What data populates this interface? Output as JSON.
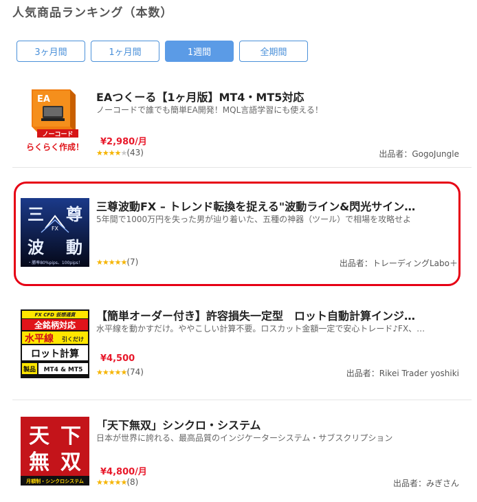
{
  "page_title": "人気商品ランキング（本数）",
  "tabs": [
    {
      "label": "3ヶ月間",
      "active": false
    },
    {
      "label": "1ヶ月間",
      "active": false
    },
    {
      "label": "1週間",
      "active": true
    },
    {
      "label": "全期間",
      "active": false
    }
  ],
  "products": [
    {
      "title": "EAつくーる【1ヶ月版】MT4・MT5対応",
      "description": "ノーコードで誰でも簡単EA開発！MQL言語学習にも使える！",
      "price": "¥2,980/月",
      "stars": 4,
      "review_count": "(43)",
      "seller": "出品者：GogoJungle",
      "thumb": {
        "box_label": "EA",
        "band_text": "ノーコード",
        "slogan": "らくらく作成！"
      }
    },
    {
      "title": "三尊波動FX – トレンド転換を捉える\"波動ライン&閃光サイン…",
      "description": "5年間で1000万円を失った男が辿り着いた、五種の神器（ツール）で相場を攻略せよ",
      "price": "",
      "stars": 5,
      "review_count": "(7)",
      "seller": "出品者：トレーディングLabo＋",
      "highlighted": true,
      "thumb": {
        "chars": [
          "三",
          "尊",
          "波",
          "動"
        ],
        "badge": "FX",
        "footer": "・勝率80%pips、100pips！"
      }
    },
    {
      "title": "【簡単オーダー付き】許容損失一定型　ロット自動計算インジ…",
      "description": "水平線を動かすだけ。ややこしい計算不要。ロスカット金額一定で安心トレード♪FX、…",
      "price": "¥4,500",
      "stars": 5,
      "review_count": "(74)",
      "seller": "出品者：Rikei Trader yoshiki",
      "thumb": {
        "line1": "FX CFD 仮想通貨",
        "line2": "全銘柄対応",
        "line3": "水平線",
        "line3b": "引くだけ",
        "line4": "ロット計算",
        "line5a": "製品",
        "line5b": "MT4 & MT5"
      }
    },
    {
      "title": "「天下無双」シンクロ・システム",
      "description": "日本が世界に誇れる、最高品質のインジケーターシステム・サブスクリプション",
      "price": "¥4,800/月",
      "stars": 5,
      "review_count": "(8)",
      "seller": "出品者：みぎさん",
      "thumb": {
        "chars": [
          "天",
          "下",
          "無",
          "双"
        ],
        "footer": "月額制・シンクロシステム"
      }
    }
  ]
}
